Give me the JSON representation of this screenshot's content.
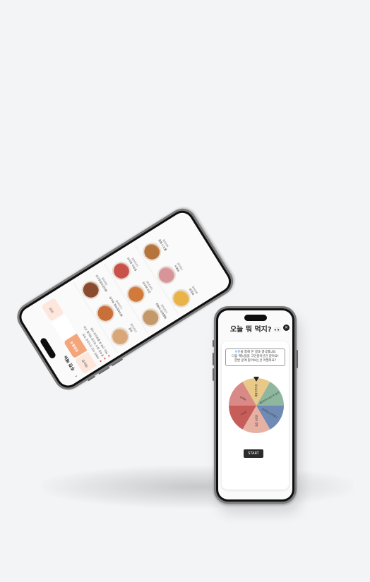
{
  "roulette_app": {
    "title": "오늘 뭐 먹지?",
    "title_emoji": "👀",
    "prompt_highlight": "사진",
    "prompt_line1": "을 통해 본 결과 결식했냐요",
    "prompt_line2": "다음 메뉴들을 고민중이신건 같아요!",
    "prompt_line3": "한번 운에 맡겨보는건 어떨까요?",
    "start_label": "START",
    "wheel_segments": [
      {
        "label": "해물어묵우동",
        "color": "#e8c987"
      },
      {
        "label": "베이컨치즈토스트 토리",
        "color": "#8fb79f"
      },
      {
        "label": "치즈마스크카포니",
        "color": "#6f8ab4"
      },
      {
        "label": "닭갈비 덮밥",
        "color": "#e6b0a3"
      },
      {
        "label": "돈까스",
        "color": "#c65d59"
      },
      {
        "label": "짜장면",
        "color": "#d98986"
      }
    ]
  },
  "menu_app": {
    "back_icon": "chevron-left-icon",
    "title": "추천 메뉴",
    "tabs": [
      "메뉴판",
      "모든음식",
      "",
      "이전"
    ],
    "info_lines": [
      "카메라 사진 인식으로 추천",
      "분석된 음식 비슷한 메뉴를 추천",
      "메뉴 선택 후 룰렛으로 이동"
    ],
    "items": [
      {
        "name": "초밥",
        "price": "10000원",
        "color": "#d9a777"
      },
      {
        "name": "베이컨토마토 파스타",
        "price": "11000원",
        "color": "#c86f3a"
      },
      {
        "name": "베이컨치즈토스트",
        "price": "9000원",
        "color": "#8a4a2e"
      },
      {
        "name": "해물파전 어묵탕",
        "price": "12000원",
        "color": "#c4996a"
      },
      {
        "name": "김치 파스타",
        "price": "10000원",
        "color": "#d27a3b"
      },
      {
        "name": "돈까스 파스타",
        "price": "10500원",
        "color": "#c9514a"
      },
      {
        "name": "짜장면",
        "price": "8000원",
        "color": "#e9b447"
      },
      {
        "name": "떡볶이",
        "price": "7000원",
        "color": "#d8949b"
      },
      {
        "name": "불고기 덮밥",
        "price": "9500원",
        "color": "#b6743d"
      }
    ]
  }
}
